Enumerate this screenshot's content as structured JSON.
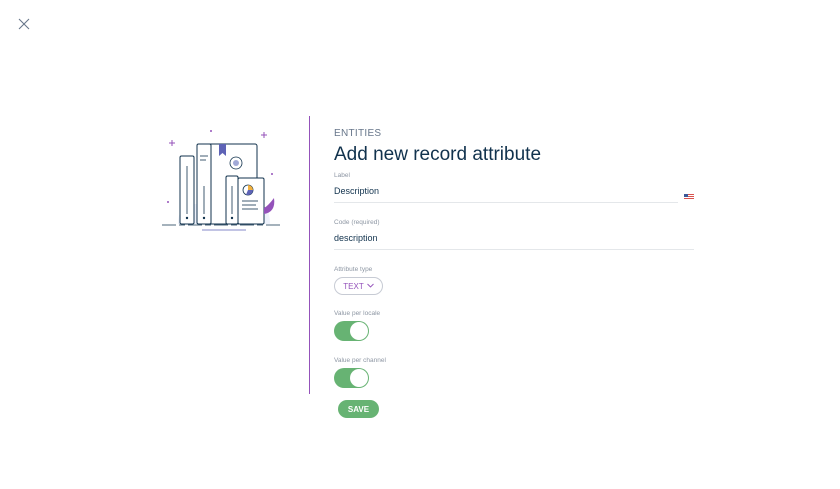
{
  "header": {
    "close_icon": "close-icon"
  },
  "form": {
    "subtitle": "ENTITIES",
    "title": "Add new record attribute",
    "label_field": {
      "label": "Label",
      "value": "Description",
      "locale_flag": "us-flag-icon"
    },
    "code_field": {
      "label": "Code (required)",
      "value": "description"
    },
    "attribute_type": {
      "label": "Attribute type",
      "selected": "TEXT",
      "chevron": "chevron-down-icon"
    },
    "value_per_locale": {
      "label": "Value per locale",
      "enabled": true
    },
    "value_per_channel": {
      "label": "Value per channel",
      "enabled": true
    },
    "save_label": "SAVE"
  },
  "colors": {
    "brand_purple": "#9452ba",
    "success_green": "#67b373",
    "text_dark": "#11324d",
    "text_muted": "#67768a"
  }
}
